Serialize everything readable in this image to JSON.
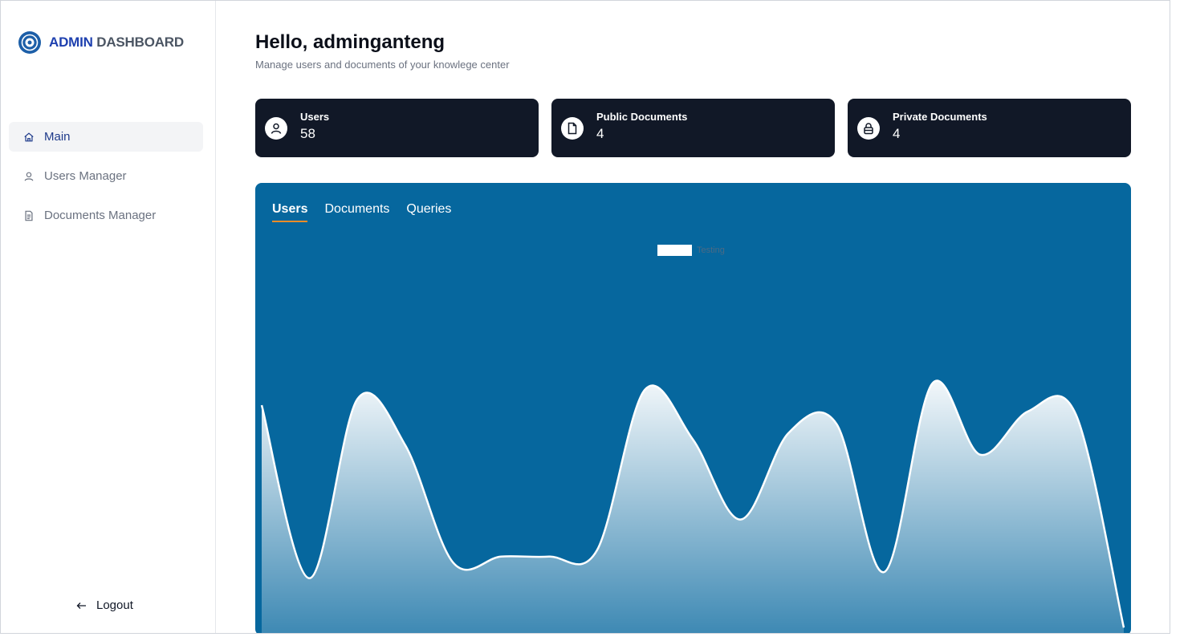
{
  "brand": {
    "name_primary": "ADMIN",
    "name_secondary": "DASHBOARD"
  },
  "sidebar": {
    "items": [
      {
        "label": "Main",
        "icon": "home-icon",
        "active": true
      },
      {
        "label": "Users Manager",
        "icon": "user-icon",
        "active": false
      },
      {
        "label": "Documents Manager",
        "icon": "document-icon",
        "active": false
      }
    ],
    "logout_label": "Logout"
  },
  "header": {
    "greeting": "Hello, adminganteng",
    "subtitle": "Manage users and documents of your knowlege center"
  },
  "stats": [
    {
      "label": "Users",
      "value": "58",
      "icon": "user-icon"
    },
    {
      "label": "Public Documents",
      "value": "4",
      "icon": "document-icon"
    },
    {
      "label": "Private Documents",
      "value": "4",
      "icon": "lock-icon"
    }
  ],
  "panel": {
    "tabs": [
      {
        "label": "Users",
        "active": true
      },
      {
        "label": "Documents",
        "active": false
      },
      {
        "label": "Queries",
        "active": false
      }
    ]
  },
  "colors": {
    "panel_bg": "#06679e",
    "card_bg": "#111827",
    "tab_underline": "#f28c28",
    "brand_blue": "#1e40af"
  },
  "chart_data": {
    "type": "area",
    "legend": [
      "Testing"
    ],
    "legend_position": "top-center",
    "series": [
      {
        "name": "Testing",
        "values": [
          64,
          8,
          66,
          51,
          13,
          15,
          15,
          17,
          69,
          53,
          27,
          55,
          58,
          10,
          71,
          48,
          62,
          61,
          -8
        ]
      }
    ],
    "ylim": [
      -10,
      110
    ],
    "grid": false,
    "smooth": true
  }
}
